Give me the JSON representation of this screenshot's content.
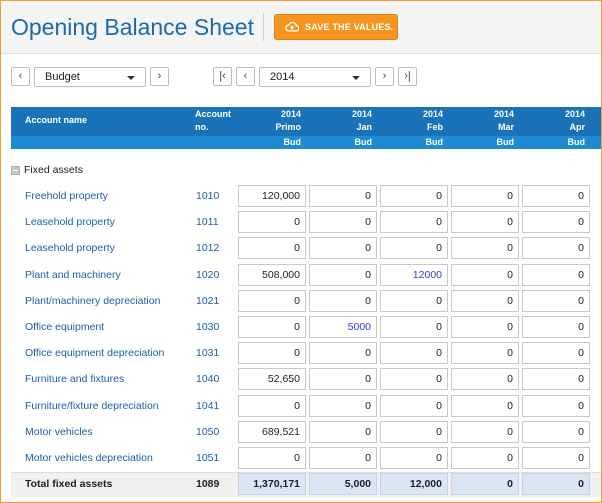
{
  "header": {
    "title": "Opening Balance Sheet",
    "save_label": "SAVE THE VALUES."
  },
  "toolbar": {
    "budget_select": "Budget",
    "year_select": "2014"
  },
  "table": {
    "col_account_name": "Account name",
    "col_account_no_1": "Account",
    "col_account_no_2": "no.",
    "periods": [
      {
        "year": "2014",
        "label": "Primo",
        "bud": "Bud"
      },
      {
        "year": "2014",
        "label": "Jan",
        "bud": "Bud"
      },
      {
        "year": "2014",
        "label": "Feb",
        "bud": "Bud"
      },
      {
        "year": "2014",
        "label": "Mar",
        "bud": "Bud"
      },
      {
        "year": "2014",
        "label": "Apr",
        "bud": "Bud"
      }
    ],
    "section": "Fixed assets",
    "rows": [
      {
        "name": "Freehold property",
        "no": "1010",
        "values": [
          "120,000",
          "0",
          "0",
          "0",
          "0"
        ]
      },
      {
        "name": "Leasehold property",
        "no": "1011",
        "values": [
          "0",
          "0",
          "0",
          "0",
          "0"
        ]
      },
      {
        "name": "Leasehold property",
        "no": "1012",
        "values": [
          "0",
          "0",
          "0",
          "0",
          "0"
        ]
      },
      {
        "name": "Plant and machinery",
        "no": "1020",
        "values": [
          "508,000",
          "0",
          "12000",
          "0",
          "0"
        ]
      },
      {
        "name": "Plant/machinery depreciation",
        "no": "1021",
        "values": [
          "0",
          "0",
          "0",
          "0",
          "0"
        ]
      },
      {
        "name": "Office equipment",
        "no": "1030",
        "values": [
          "0",
          "5000",
          "0",
          "0",
          "0"
        ]
      },
      {
        "name": "Office equipment depreciation",
        "no": "1031",
        "values": [
          "0",
          "0",
          "0",
          "0",
          "0"
        ]
      },
      {
        "name": "Furniture and fixtures",
        "no": "1040",
        "values": [
          "52,650",
          "0",
          "0",
          "0",
          "0"
        ]
      },
      {
        "name": "Furniture/fixture depreciation",
        "no": "1041",
        "values": [
          "0",
          "0",
          "0",
          "0",
          "0"
        ]
      },
      {
        "name": "Motor vehicles",
        "no": "1050",
        "values": [
          "689,521",
          "0",
          "0",
          "0",
          "0"
        ]
      },
      {
        "name": "Motor vehicles depreciation",
        "no": "1051",
        "values": [
          "0",
          "0",
          "0",
          "0",
          "0"
        ]
      }
    ],
    "total": {
      "name": "Total fixed assets",
      "no": "1089",
      "values": [
        "1,370,171",
        "5,000",
        "12,000",
        "0",
        "0"
      ]
    }
  },
  "colors": {
    "accent": "#f5941f",
    "header": "#1a73b8",
    "link": "#1c5fa8",
    "edited": "#2a3fd0"
  }
}
